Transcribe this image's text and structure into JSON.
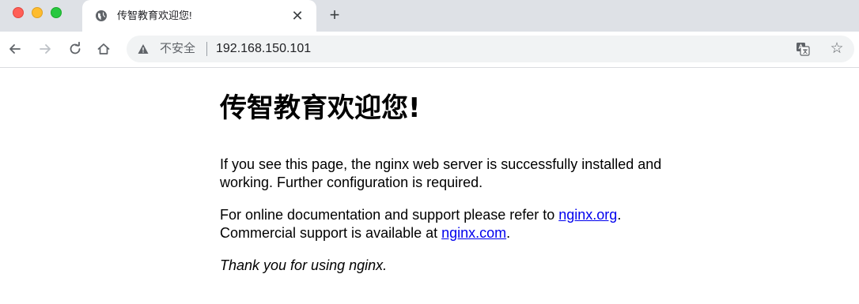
{
  "tab": {
    "title": "传智教育欢迎您!",
    "close_glyph": "✕",
    "new_tab_glyph": "+"
  },
  "toolbar": {
    "security_label": "不安全",
    "url": "192.168.150.101",
    "star_glyph": "☆"
  },
  "page": {
    "heading": "传智教育欢迎您!",
    "para1_line1": "If you see this page, the nginx web server is successfully installed and",
    "para1_line2": "working. Further configuration is required.",
    "para2_prefix": "For online documentation and support please refer to ",
    "link_org": "nginx.org",
    "para2_mid_end": ".",
    "para2_line2_prefix": "Commercial support is available at ",
    "link_com": "nginx.com",
    "para2_line2_end": ".",
    "thanks": "Thank you for using nginx."
  },
  "icons": {
    "favicon": "globe-icon",
    "back": "arrow-left-icon",
    "forward": "arrow-right-icon",
    "reload": "reload-icon",
    "home": "home-icon",
    "security": "warning-icon",
    "translate": "translate-icon",
    "bookmark": "star-icon"
  },
  "colors": {
    "tabstrip": "#dee1e6",
    "omnibox": "#f1f3f4",
    "link": "#0000ee"
  }
}
